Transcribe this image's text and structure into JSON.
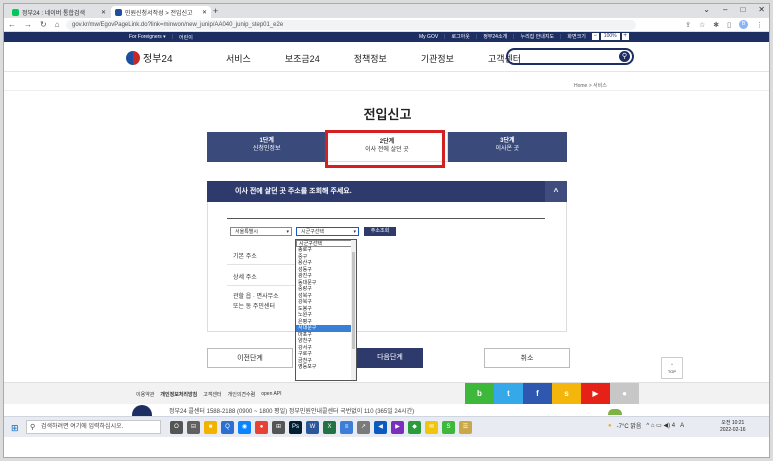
{
  "browser": {
    "tabs": [
      {
        "title": "정부24 : 네이버 통합검색",
        "favicon_color": "#03c75a"
      },
      {
        "title": "민원신청서작성 > 전입신고",
        "favicon_color": "#1d4ea0"
      }
    ],
    "close_glyph": "✕",
    "new_tab_glyph": "+",
    "url": "gov.kr/mw/EgovPageLink.do?link=minwon/new_junip/AA040_junip_step01_e2e",
    "profile_initial": "B"
  },
  "site": {
    "topbar": {
      "for_foreigners": "For Foreigners ▾",
      "kids": "어린이",
      "links": [
        "My GOV",
        "로그아웃",
        "정부24소개",
        "누리집 안내지도",
        "화면크기"
      ],
      "zoom_minus": "−",
      "zoom_value": "100%",
      "zoom_plus": "+"
    },
    "logo_text": "정부24",
    "nav": [
      "서비스",
      "보조금24",
      "정책정보",
      "기관정보",
      "고객센터"
    ],
    "breadcrumb": "Home > 서비스",
    "page_title": "전입신고",
    "steps": [
      {
        "num": "1단계",
        "label": "신청인정보"
      },
      {
        "num": "2단계",
        "label": "이사 전에 살던 곳"
      },
      {
        "num": "3단계",
        "label": "이사온 곳"
      }
    ],
    "panel": {
      "title": "이사 전에 살던 곳 주소를 조회해 주세요.",
      "toggle_glyph": "^",
      "city_select": "서울특별시",
      "district_select": "시군구선택",
      "address_button": "주소조회",
      "fields": [
        "기본 주소",
        "상세 주소",
        "관할 읍 · 면사무소",
        "또는 동 주민센터"
      ]
    },
    "district_options": [
      "시군구선택",
      "종로구",
      "중구",
      "용산구",
      "성동구",
      "광진구",
      "동대문구",
      "중랑구",
      "성북구",
      "강북구",
      "도봉구",
      "노원구",
      "은평구",
      "서대문구",
      "마포구",
      "양천구",
      "강서구",
      "구로구",
      "금천구",
      "영등포구"
    ],
    "highlighted_option": "서대문구",
    "buttons": {
      "prev": "이전단계",
      "next": "다음단계",
      "cancel": "취소",
      "top": "TOP",
      "top_glyph": "^"
    },
    "footer": {
      "links": [
        "이용약관",
        "개인정보처리방침",
        "고객센터",
        "개인의견수렴",
        "open API"
      ],
      "social": [
        {
          "label": "b",
          "color": "#3db83a"
        },
        {
          "label": "t",
          "color": "#34a8e8"
        },
        {
          "label": "f",
          "color": "#2e58b0"
        },
        {
          "label": "s",
          "color": "#f5b60b"
        },
        {
          "label": "▶",
          "color": "#e62117"
        },
        {
          "label": "●",
          "color": "#c7c7c7"
        }
      ],
      "contact": "정부24 콜센터 1588-2188 (0900 ~ 1800 평일) 정부민원안내콜센터 국번없이 110 (365일 24시간)"
    }
  },
  "taskbar": {
    "search_placeholder": "검색하려면 여기에 입력하십시오.",
    "search_glyph": "⚲",
    "start_glyph": "⊞",
    "apps": [
      {
        "label": "O",
        "color": "#555555"
      },
      {
        "label": "⊟",
        "color": "#606060"
      },
      {
        "label": "■",
        "color": "#f3b200"
      },
      {
        "label": "Q",
        "color": "#2c6fd1"
      },
      {
        "label": "◉",
        "color": "#0a84ff"
      },
      {
        "label": "●",
        "color": "#e94235"
      },
      {
        "label": "⊞",
        "color": "#555555"
      },
      {
        "label": "Ps",
        "color": "#001e36"
      },
      {
        "label": "W",
        "color": "#2b579a"
      },
      {
        "label": "X",
        "color": "#217346"
      },
      {
        "label": "≡",
        "color": "#3d7fd8"
      },
      {
        "label": "↗",
        "color": "#7a7a7a"
      },
      {
        "label": "◀",
        "color": "#0b5bbf"
      },
      {
        "label": "▶",
        "color": "#7b2fbf"
      },
      {
        "label": "◆",
        "color": "#2a9d3b"
      },
      {
        "label": "✉",
        "color": "#f1c40f"
      },
      {
        "label": "S",
        "color": "#3db83a"
      },
      {
        "label": "☰",
        "color": "#c9a84a"
      }
    ],
    "weather": "-7°C 맑음",
    "tray_symbols": "^  ⌂  ▭  ◀) 4",
    "ime": "A",
    "time": "오전 10:21",
    "date": "2022-02-16"
  }
}
